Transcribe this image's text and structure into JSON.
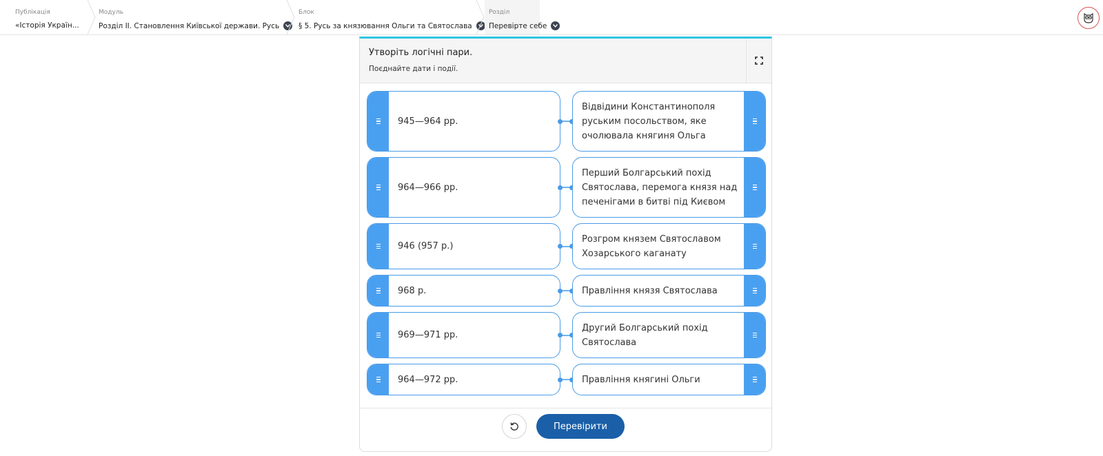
{
  "breadcrumbs": [
    {
      "caption": "Публікація",
      "value": "«Історія Україн..."
    },
    {
      "caption": "Модуль",
      "value": "Розділ ІІ. Становлення Київської держави. Русь"
    },
    {
      "caption": "Блок",
      "value": "§ 5. Русь за князювання Ольги та Святослава"
    },
    {
      "caption": "Розділ",
      "value": "Перевірте себе"
    }
  ],
  "exercise": {
    "title": "Утворіть логічні пари.",
    "subtitle": "Поєднайте дати і події.",
    "pairs": [
      {
        "left": "945—964 рр.",
        "right": "Відвідини Константинополя руським посольством, яке очолювала княгиня Ольга"
      },
      {
        "left": "964—966 рр.",
        "right": "Перший Болгарський похід Святослава, перемога князя над печенігами в битві під Києвом"
      },
      {
        "left": "946 (957 р.)",
        "right": "Розгром князем Святославом Хозарського каганату"
      },
      {
        "left": "968 р.",
        "right": "Правління князя Святослава"
      },
      {
        "left": "969—971 рр.",
        "right": "Другий Болгарський похід Святослава"
      },
      {
        "left": "964—972 рр.",
        "right": "Правління княгині Ольги"
      }
    ],
    "check_label": "Перевірити"
  },
  "colors": {
    "accent_top": "#2ec4e0",
    "handle": "#4aa0f0",
    "tile_border": "#4a9be8",
    "check_button": "#1a5fa8"
  },
  "icons": {
    "fullscreen": "fullscreen-icon",
    "reset": "reset-icon",
    "handle": "drag-handle-icon",
    "dropdown": "chevron-down-icon",
    "avatar": "owl-logo-icon"
  }
}
